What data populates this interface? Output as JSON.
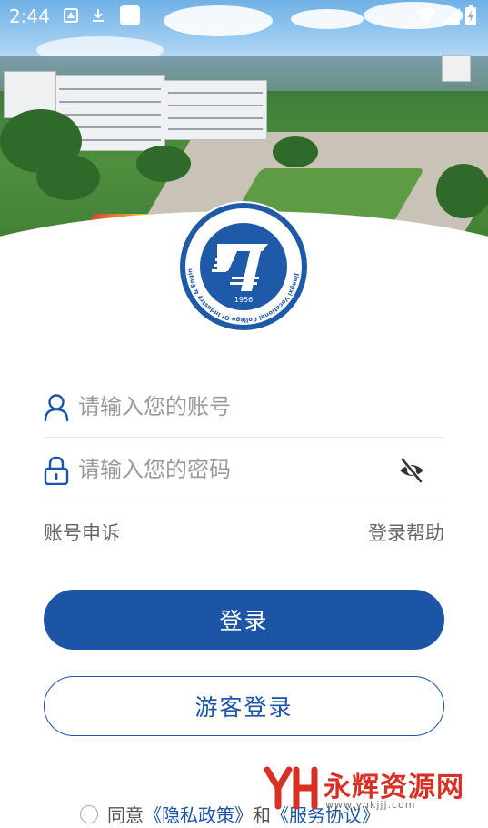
{
  "status_bar": {
    "time": "2:44"
  },
  "login": {
    "account_placeholder": "请输入您的账号",
    "password_placeholder": "请输入您的密码",
    "appeal_link": "账号申诉",
    "help_link": "登录帮助",
    "login_button": "登录",
    "guest_button": "游客登录"
  },
  "agreement": {
    "prefix": "同意",
    "privacy_link": "《隐私政策》",
    "conj": "和",
    "service_link": "《服务协议》"
  },
  "emblem": {
    "year": "1956",
    "english_name": "Jiangxi Vocational College Of Industry & Engineering"
  },
  "watermark": {
    "brand": "永辉资源网",
    "url": "www.yhkjjj.com"
  },
  "colors": {
    "primary": "#1c55a6",
    "watermark": "#d93025"
  },
  "icons": [
    "user-icon",
    "lock-icon",
    "eye-off-icon",
    "wifi-icon",
    "signal-icon",
    "battery-icon"
  ]
}
